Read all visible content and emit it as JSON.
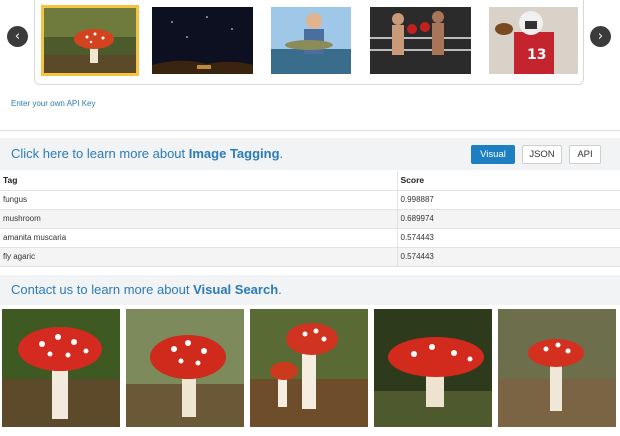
{
  "carousel": {
    "prev_icon": "‹",
    "next_icon": "›",
    "thumbnails": [
      {
        "subject": "mushroom",
        "selected": true
      },
      {
        "subject": "night-sky",
        "selected": false
      },
      {
        "subject": "fisherman",
        "selected": false
      },
      {
        "subject": "boxing",
        "selected": false
      },
      {
        "subject": "football-player",
        "selected": false
      }
    ]
  },
  "api_link": "Enter your own API Key",
  "tagging": {
    "title_prefix": "Click here to learn more about ",
    "title_bold": "Image Tagging",
    "title_suffix": ".",
    "buttons": {
      "visual": "Visual",
      "json": "JSON",
      "api": "API"
    },
    "active_button": "visual",
    "columns": {
      "tag": "Tag",
      "score": "Score"
    },
    "rows": [
      {
        "tag": "fungus",
        "score": "0.998887"
      },
      {
        "tag": "mushroom",
        "score": "0.689974"
      },
      {
        "tag": "amanita muscaria",
        "score": "0.574443"
      },
      {
        "tag": "fly agaric",
        "score": "0.574443"
      }
    ]
  },
  "visual_search": {
    "title_prefix": "Contact us to learn more about ",
    "title_bold": "Visual Search",
    "title_suffix": "."
  },
  "colors": {
    "link": "#2b7bb9",
    "active_button": "#1d7fc1",
    "selected_border": "#f5c242",
    "mushroom_cap": "#d42a1f"
  }
}
